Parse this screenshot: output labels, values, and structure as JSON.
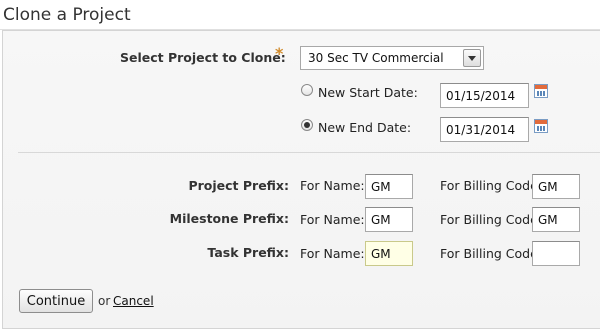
{
  "page": {
    "title": "Clone a Project"
  },
  "clone": {
    "select_label": "Select Project to Clone:",
    "required_mark": "*",
    "project_value": "30 Sec TV Commercial",
    "new_start_label": "New Start Date:",
    "new_start_value": "01/15/2014",
    "new_end_label": "New End Date:",
    "new_end_value": "01/31/2014",
    "selected_date_option": "new_end"
  },
  "prefixes": {
    "for_name_label": "For Name:",
    "for_billing_label": "For Billing Code:",
    "rows": [
      {
        "label": "Project Prefix:",
        "name_value": "GM",
        "billing_value": "GM"
      },
      {
        "label": "Milestone Prefix:",
        "name_value": "GM",
        "billing_value": "GM"
      },
      {
        "label": "Task Prefix:",
        "name_value": "GM",
        "billing_value": ""
      }
    ]
  },
  "actions": {
    "continue_label": "Continue",
    "or_text": "or",
    "cancel_label": "Cancel"
  }
}
